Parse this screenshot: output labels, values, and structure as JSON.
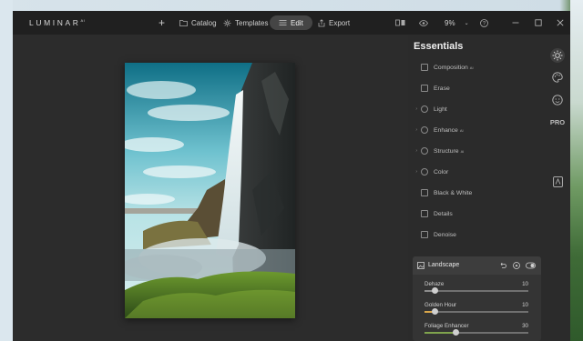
{
  "app": {
    "brand": "LUMINAR",
    "brand_sup": "AI"
  },
  "toolbar": {
    "add_label": "+",
    "catalog_label": "Catalog",
    "templates_label": "Templates",
    "edit_label": "Edit",
    "export_label": "Export",
    "zoom": "9%"
  },
  "panel": {
    "title": "Essentials",
    "tools": [
      {
        "label": "Composition",
        "ai": "AI",
        "expandable": false
      },
      {
        "label": "Erase",
        "ai": "",
        "expandable": false
      },
      {
        "label": "Light",
        "ai": "",
        "expandable": true
      },
      {
        "label": "Enhance",
        "ai": "AI",
        "expandable": true
      },
      {
        "label": "Structure",
        "ai": "AI",
        "expandable": true
      },
      {
        "label": "Color",
        "ai": "",
        "expandable": true
      },
      {
        "label": "Black & White",
        "ai": "",
        "expandable": false
      },
      {
        "label": "Details",
        "ai": "",
        "expandable": false
      },
      {
        "label": "Denoise",
        "ai": "",
        "expandable": false
      }
    ],
    "landscape": {
      "title": "Landscape",
      "sliders": [
        {
          "label": "Dehaze",
          "value": 10,
          "fraction": 0.1,
          "fill_color": "#8d8d8d"
        },
        {
          "label": "Golden Hour",
          "value": 10,
          "fraction": 0.1,
          "fill_color": "#d8a64a"
        },
        {
          "label": "Foliage Enhancer",
          "value": 30,
          "fraction": 0.3,
          "fill_color": "#7fa34d"
        }
      ]
    }
  },
  "rail": {
    "pro_label": "PRO"
  }
}
